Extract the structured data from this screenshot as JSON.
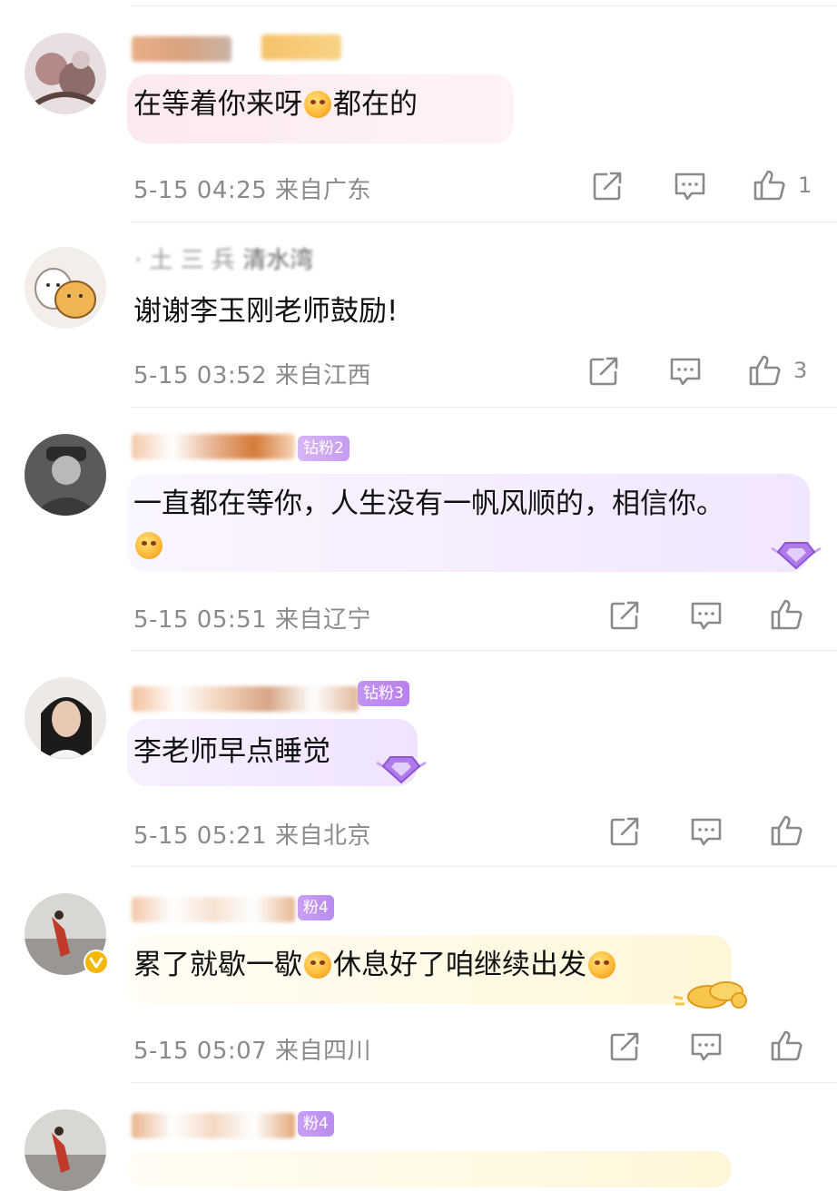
{
  "comments": [
    {
      "content": "在等着你来呀",
      "content_tail": "都在的",
      "time": "5-15 04:25",
      "location": "来自广东",
      "likes": "1",
      "bubble_color": "#fff1f3"
    },
    {
      "username_partial": "清水湾",
      "content": "谢谢李玉刚老师鼓励!",
      "time": "5-15 03:52",
      "location": "来自江西",
      "likes": "3"
    },
    {
      "badge": "钻粉2",
      "content": "一直都在等你，人生没有一帆风顺的，相信你。",
      "time": "5-15 05:51",
      "location": "来自辽宁",
      "bubble_color": "#f6efff"
    },
    {
      "badge": "钻粉3",
      "content": "李老师早点睡觉",
      "time": "5-15 05:21",
      "location": "来自北京",
      "bubble_color": "#f7f0ff"
    },
    {
      "badge": "粉4",
      "content_a": "累了就歇一歇",
      "content_b": "休息好了咱继续出发",
      "time": "5-15 05:07",
      "location": "来自四川",
      "bubble_color": "#fffbe9",
      "verified": true
    },
    {
      "badge": "粉4"
    }
  ],
  "icons": {
    "share": "share-icon",
    "comment": "comment-icon",
    "like": "like-icon"
  },
  "colors": {
    "badge_purple": "#b98cf0",
    "meta_gray": "#8a8a8a"
  }
}
